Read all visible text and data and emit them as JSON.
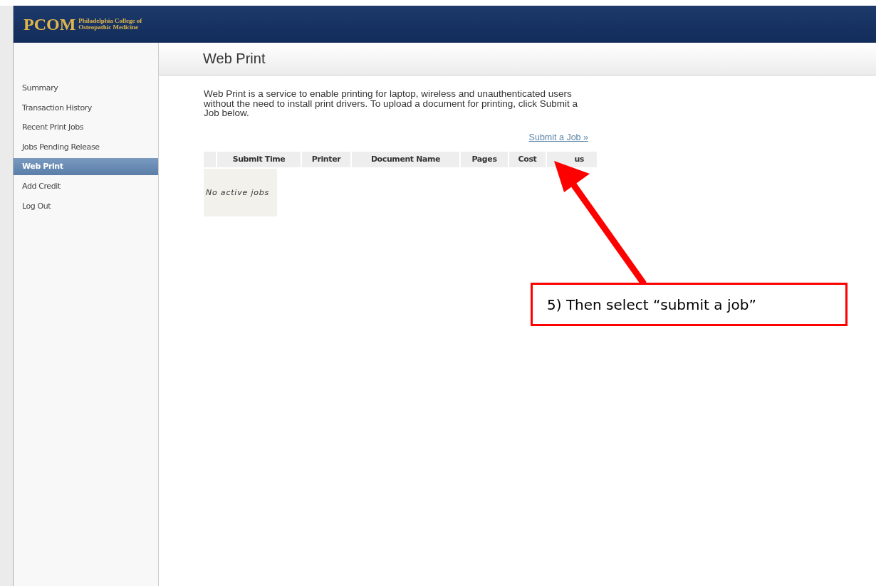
{
  "header": {
    "logo": "PCOM",
    "college": "Philadelphia College of Osteopathic Medicine"
  },
  "sidebar": {
    "items": [
      {
        "label": "Summary",
        "selected": false
      },
      {
        "label": "Transaction History",
        "selected": false
      },
      {
        "label": "Recent Print Jobs",
        "selected": false
      },
      {
        "label": "Jobs Pending Release",
        "selected": false
      },
      {
        "label": "Web Print",
        "selected": true
      },
      {
        "label": "Add Credit",
        "selected": false
      },
      {
        "label": "Log Out",
        "selected": false
      }
    ]
  },
  "page": {
    "title": "Web Print",
    "intro": "Web Print is a service to enable printing for laptop, wireless and unauthenticated users without the need to install print drivers. To upload a document for printing, click Submit a Job below.",
    "submit_link": "Submit a Job »"
  },
  "table": {
    "columns": [
      "Submit Time",
      "Printer",
      "Document Name",
      "Pages",
      "Cost",
      "us"
    ],
    "empty": "No active jobs"
  },
  "annotation": {
    "callout": "5) Then select “submit a job”"
  }
}
